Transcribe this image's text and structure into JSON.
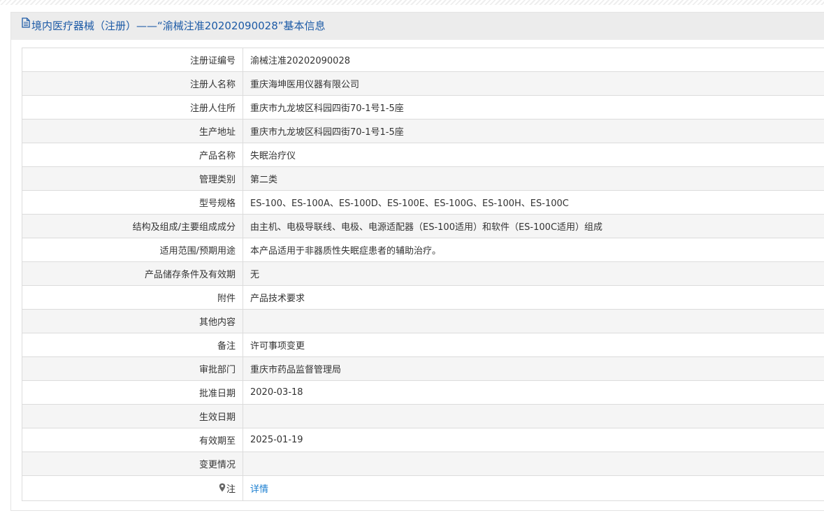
{
  "header": {
    "title": "境内医疗器械（注册）——“渝械注准20202090028”基本信息"
  },
  "rows": [
    {
      "label": "注册证编号",
      "value": "渝械注准20202090028"
    },
    {
      "label": "注册人名称",
      "value": "重庆海坤医用仪器有限公司"
    },
    {
      "label": "注册人住所",
      "value": "重庆市九龙坡区科园四街70-1号1-5座"
    },
    {
      "label": "生产地址",
      "value": "重庆市九龙坡区科园四街70-1号1-5座"
    },
    {
      "label": "产品名称",
      "value": "失眠治疗仪"
    },
    {
      "label": "管理类别",
      "value": "第二类"
    },
    {
      "label": "型号规格",
      "value": "ES-100、ES-100A、ES-100D、ES-100E、ES-100G、ES-100H、ES-100C"
    },
    {
      "label": "结构及组成/主要组成成分",
      "value": "由主机、电极导联线、电极、电源适配器（ES-100适用）和软件（ES-100C适用）组成"
    },
    {
      "label": "适用范围/预期用途",
      "value": "本产品适用于非器质性失眠症患者的辅助治疗。"
    },
    {
      "label": "产品储存条件及有效期",
      "value": "无"
    },
    {
      "label": "附件",
      "value": "产品技术要求"
    },
    {
      "label": "其他内容",
      "value": ""
    },
    {
      "label": "备注",
      "value": "许可事项变更"
    },
    {
      "label": "审批部门",
      "value": "重庆市药品监督管理局"
    },
    {
      "label": "批准日期",
      "value": "2020-03-18"
    },
    {
      "label": "生效日期",
      "value": ""
    },
    {
      "label": "有效期至",
      "value": "2025-01-19"
    },
    {
      "label": "变更情况",
      "value": ""
    }
  ],
  "note": {
    "label": "注",
    "link_label": "详情",
    "icon": "pin-icon"
  },
  "icons": {
    "header_icon": "document-icon"
  },
  "colors": {
    "header_text": "#1c5aa6",
    "link": "#1a7ed0",
    "header_bg": "#ececec",
    "alt_row_bg": "#f5f5f5"
  }
}
